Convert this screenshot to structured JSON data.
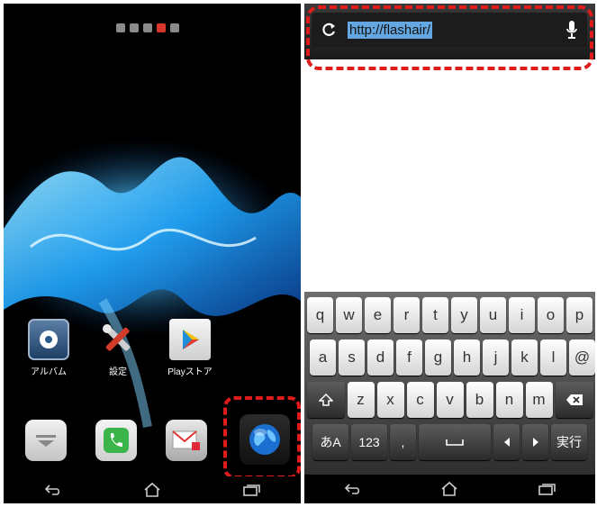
{
  "home": {
    "page_indicator": {
      "count": 5,
      "active_index": 3
    },
    "apps": {
      "album": {
        "label": "アルバム",
        "icon": "album-icon"
      },
      "settings": {
        "label": "設定",
        "icon": "settings-tools-icon"
      },
      "play_store": {
        "label": "Playストア",
        "icon": "play-store-icon"
      }
    },
    "dock": [
      "app-drawer-icon",
      "phone-icon",
      "mail-icon",
      "browser-globe-icon"
    ],
    "highlight_color": "#e01b1b"
  },
  "browser": {
    "url": "http://flashair/",
    "reload_icon": "reload-icon",
    "mic_icon": "microphone-icon"
  },
  "keyboard": {
    "row1": [
      "q",
      "w",
      "e",
      "r",
      "t",
      "y",
      "u",
      "i",
      "o",
      "p"
    ],
    "row2": [
      "a",
      "s",
      "d",
      "f",
      "g",
      "h",
      "j",
      "k",
      "l",
      "@"
    ],
    "row3_letters": [
      "z",
      "x",
      "c",
      "v",
      "b",
      "n",
      "m"
    ],
    "mode_label": "あA",
    "num_label": "123",
    "comma": ",",
    "enter_label": "実行"
  },
  "colors": {
    "url_selection": "#64a7e0",
    "wave": "#2aa8ff"
  }
}
